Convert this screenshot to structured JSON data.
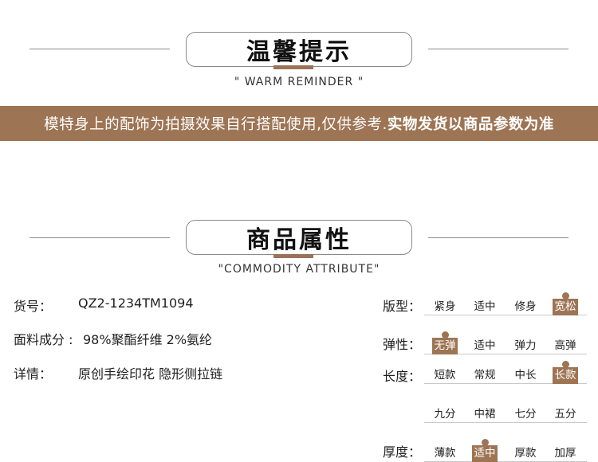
{
  "reminder": {
    "title": "温馨提示",
    "subtitle": "\" WARM REMINDER \"",
    "notice_prefix": "模特身上的配饰为拍摄效果自行搭配使用,仅供参考.",
    "notice_emphasis": "实物发货以商品参数为准"
  },
  "attribute": {
    "title": "商品属性",
    "subtitle": "\"COMMODITY ATTRIBUTE\""
  },
  "details": {
    "sku_label": "货号：",
    "sku_value": "QZ2-1234TM1094",
    "fabric_label": "面料成分 :",
    "fabric_value": "98%聚酯纤维 2%氨纶",
    "detail_label": "详情：",
    "detail_value": "原创手绘印花 隐形侧拉链"
  },
  "specs": {
    "fit": {
      "label": "版型：",
      "options": [
        "紧身",
        "适中",
        "修身",
        "宽松"
      ],
      "selected": 3
    },
    "elasticity": {
      "label": "弹性：",
      "options": [
        "无弹",
        "适中",
        "弹力",
        "高弹"
      ],
      "selected": 0
    },
    "length": {
      "label": "长度：",
      "options": [
        "短款",
        "常规",
        "中长",
        "长款"
      ],
      "selected": 3
    },
    "length_more": {
      "options": [
        "九分",
        "中裙",
        "七分",
        "五分"
      ]
    },
    "thickness": {
      "label": "厚度：",
      "options": [
        "薄款",
        "适中",
        "厚款",
        "加厚"
      ],
      "selected": 1
    }
  },
  "colors": {
    "accent": "#9d7454",
    "rule": "#8c8c8c"
  }
}
